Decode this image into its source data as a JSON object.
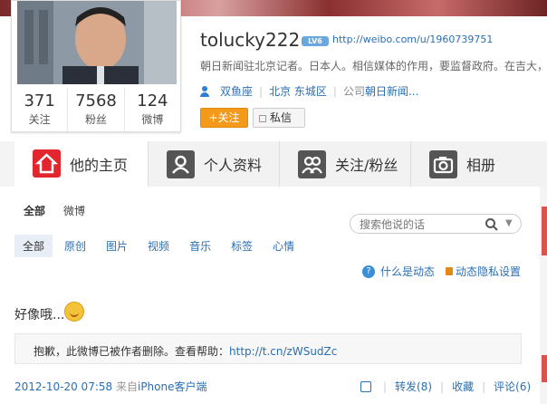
{
  "profile": {
    "username": "tolucky222",
    "level_badge": "LV6",
    "url": "http://weibo.com/u/1960739751",
    "bio": "朝日新闻驻北京记者。日本人。相信媒体的作用，要监督政府。在吉大，",
    "zodiac": "双鱼座",
    "location": "北京 东城区",
    "company_label": "公司",
    "company": "朝日新闻...",
    "follow_label": "+关注",
    "message_label": "私信"
  },
  "stats": [
    {
      "num": "371",
      "label": "关注"
    },
    {
      "num": "7568",
      "label": "粉丝"
    },
    {
      "num": "124",
      "label": "微博"
    }
  ],
  "tabs": [
    {
      "label": "他的主页",
      "icon": "home-icon",
      "active": true
    },
    {
      "label": "个人资料",
      "icon": "person-icon",
      "active": false
    },
    {
      "label": "关注/粉丝",
      "icon": "people-icon",
      "active": false
    },
    {
      "label": "相册",
      "icon": "camera-icon",
      "active": false
    }
  ],
  "feed_filter": {
    "all": "全部",
    "weibo": "微博"
  },
  "search": {
    "placeholder": "搜索他说的话"
  },
  "type_filters": [
    "全部",
    "原创",
    "图片",
    "视频",
    "音乐",
    "标签",
    "心情"
  ],
  "help": {
    "what_is_feed": "什么是动态",
    "privacy": "动态隐私设置"
  },
  "post": {
    "text": "好像哦...",
    "deleted_notice": "抱歉，此微博已被作者删除。查看帮助：",
    "help_link": "http://t.cn/zWSudZc",
    "timestamp": "2012-10-20 07:58",
    "source_prefix": "来自",
    "source": "iPhone客户端",
    "repost": "转发(8)",
    "favorite": "收藏",
    "comment": "评论(6)"
  },
  "colors": {
    "accent_red": "#e3262e",
    "link_blue": "#2a6fb3",
    "follow_orange": "#f39a1c"
  }
}
